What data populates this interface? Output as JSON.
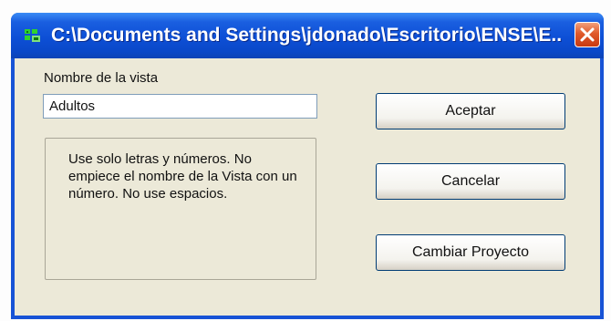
{
  "window": {
    "title": "C:\\Documents and Settings\\jdonado\\Escritorio\\ENSE\\E...",
    "app_icon": "green-app-icon",
    "close_icon": "close-x-icon",
    "colors": {
      "titlebar": "#0d4fd6",
      "face": "#ece9d8",
      "close": "#e05a2b"
    }
  },
  "form": {
    "name_label": "Nombre de la vista",
    "name_value": "Adultos",
    "info_text": "Use solo letras y números. No empiece el nombre de la Vista con un número. No use espacios."
  },
  "buttons": {
    "accept": "Aceptar",
    "cancel": "Cancelar",
    "change_project": "Cambiar Proyecto"
  }
}
